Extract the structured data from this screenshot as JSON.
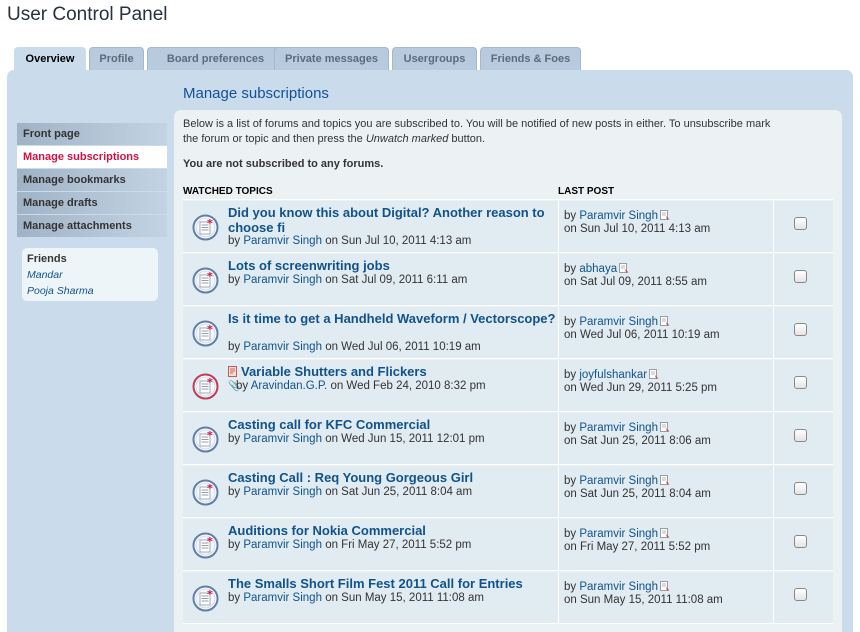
{
  "page": {
    "title": "User Control Panel"
  },
  "tabs": [
    {
      "label": "Overview",
      "active": true
    },
    {
      "label": "Profile"
    },
    {
      "label": "Board preferences"
    },
    {
      "label": "Private messages"
    },
    {
      "label": "Usergroups"
    },
    {
      "label": "Friends & Foes"
    }
  ],
  "sidebar": {
    "items": [
      {
        "label": "Front page"
      },
      {
        "label": "Manage subscriptions",
        "active": true
      },
      {
        "label": "Manage bookmarks"
      },
      {
        "label": "Manage drafts"
      },
      {
        "label": "Manage attachments"
      }
    ],
    "friends": {
      "title": "Friends",
      "list": [
        "Mandar",
        "Pooja Sharma"
      ]
    }
  },
  "main": {
    "heading": "Manage subscriptions",
    "intro_part1": "Below is a list of forums and topics you are subscribed to. You will be notified of new posts in either. To unsubscribe mark the forum or topic and then press the ",
    "intro_em": "Unwatch marked",
    "intro_part2": " button.",
    "no_forums": "You are not subscribed to any forums.",
    "col_topics": "WATCHED TOPICS",
    "col_last": "LAST POST",
    "topics": [
      {
        "title": "Did you know this about Digital? Another reason to choose fi",
        "by": "by",
        "author": "Paramvir Singh",
        "on": "on Sun Jul 10, 2011 4:13 am",
        "last_by": "by",
        "last_user": "Paramvir Singh",
        "last_date": "on Sun Jul 10, 2011 4:13 am"
      },
      {
        "title": "Lots of screenwriting jobs",
        "by": "by",
        "author": "Paramvir Singh",
        "on": "on Sat Jul 09, 2011 6:11 am",
        "last_by": "by",
        "last_user": "abhaya",
        "last_date": "on Sat Jul 09, 2011 8:55 am"
      },
      {
        "title": "Is it time to get a Handheld Waveform / Vectorscope?",
        "by": "by",
        "author": "Paramvir Singh",
        "on": "on Wed Jul 06, 2011 10:19 am",
        "last_by": "by",
        "last_user": "Paramvir Singh",
        "last_date": "on Wed Jul 06, 2011 10:19 am"
      },
      {
        "title": "Variable Shutters and Flickers",
        "by": "by",
        "author": "Aravindan.G.P.",
        "on": "on Wed Feb 24, 2010 8:32 pm",
        "last_by": "by",
        "last_user": "joyfulshankar",
        "last_date": "on Wed Jun 29, 2011 5:25 pm",
        "hot": true
      },
      {
        "title": "Casting call for KFC Commercial",
        "by": "by",
        "author": "Paramvir Singh",
        "on": "on Wed Jun 15, 2011 12:01 pm",
        "last_by": "by",
        "last_user": "Paramvir Singh",
        "last_date": "on Sat Jun 25, 2011 8:06 am"
      },
      {
        "title": "Casting Call : Req Young Gorgeous Girl",
        "by": "by",
        "author": "Paramvir Singh",
        "on": "on Sat Jun 25, 2011 8:04 am",
        "last_by": "by",
        "last_user": "Paramvir Singh",
        "last_date": "on Sat Jun 25, 2011 8:04 am"
      },
      {
        "title": "Auditions for Nokia Commercial",
        "by": "by",
        "author": "Paramvir Singh",
        "on": "on Fri May 27, 2011 5:52 pm",
        "last_by": "by",
        "last_user": "Paramvir Singh",
        "last_date": "on Fri May 27, 2011 5:52 pm"
      },
      {
        "title": "The Smalls Short Film Fest 2011 Call for Entries",
        "by": "by",
        "author": "Paramvir Singh",
        "on": "on Sun May 15, 2011 11:08 am",
        "last_by": "by",
        "last_user": "Paramvir Singh",
        "last_date": "on Sun May 15, 2011 11:08 am"
      }
    ]
  },
  "colors": {
    "accent": "#105289",
    "active_nav": "#d31141",
    "panel": "#cadceb"
  }
}
